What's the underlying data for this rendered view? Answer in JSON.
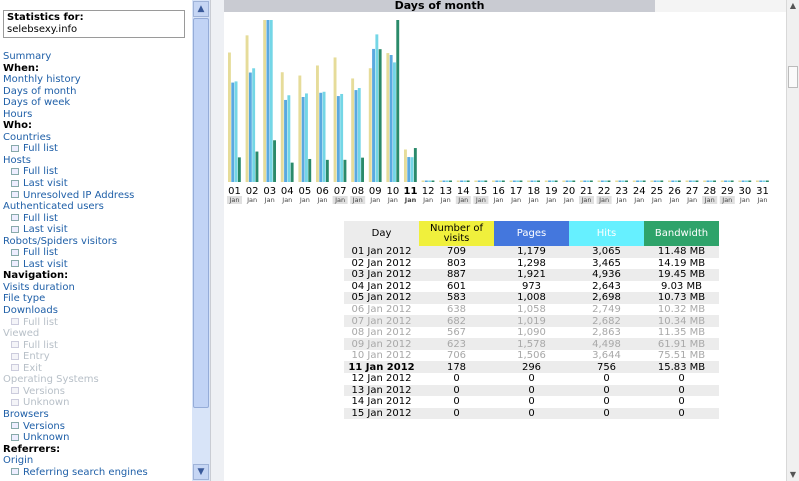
{
  "sidebar": {
    "stats_label": "Statistics for:",
    "site": "selebsexy.info",
    "items": [
      {
        "label": "Summary",
        "kind": "link"
      },
      {
        "label": "When:",
        "kind": "head"
      },
      {
        "label": "Monthly history",
        "kind": "link"
      },
      {
        "label": "Days of month",
        "kind": "link"
      },
      {
        "label": "Days of week",
        "kind": "link"
      },
      {
        "label": "Hours",
        "kind": "link"
      },
      {
        "label": "Who:",
        "kind": "head"
      },
      {
        "label": "Countries",
        "kind": "link"
      },
      {
        "label": "Full list",
        "kind": "sub"
      },
      {
        "label": "Hosts",
        "kind": "link"
      },
      {
        "label": "Full list",
        "kind": "sub"
      },
      {
        "label": "Last visit",
        "kind": "sub"
      },
      {
        "label": "Unresolved IP Address",
        "kind": "sub"
      },
      {
        "label": "Authenticated users",
        "kind": "link"
      },
      {
        "label": "Full list",
        "kind": "sub"
      },
      {
        "label": "Last visit",
        "kind": "sub"
      },
      {
        "label": "Robots/Spiders visitors",
        "kind": "link"
      },
      {
        "label": "Full list",
        "kind": "sub"
      },
      {
        "label": "Last visit",
        "kind": "sub"
      },
      {
        "label": "Navigation:",
        "kind": "head"
      },
      {
        "label": "Visits duration",
        "kind": "link"
      },
      {
        "label": "File type",
        "kind": "link"
      },
      {
        "label": "Downloads",
        "kind": "link"
      },
      {
        "label": "Full list",
        "kind": "sub-dis"
      },
      {
        "label": "Viewed",
        "kind": "dis"
      },
      {
        "label": "Full list",
        "kind": "sub-dis"
      },
      {
        "label": "Entry",
        "kind": "sub-dis"
      },
      {
        "label": "Exit",
        "kind": "sub-dis"
      },
      {
        "label": "Operating Systems",
        "kind": "dis"
      },
      {
        "label": "Versions",
        "kind": "sub-dis"
      },
      {
        "label": "Unknown",
        "kind": "sub-dis"
      },
      {
        "label": "Browsers",
        "kind": "link"
      },
      {
        "label": "Versions",
        "kind": "sub"
      },
      {
        "label": "Unknown",
        "kind": "sub"
      },
      {
        "label": "Referrers:",
        "kind": "head"
      },
      {
        "label": "Origin",
        "kind": "link"
      },
      {
        "label": "Referring search engines",
        "kind": "sub"
      }
    ]
  },
  "panel": {
    "title": "Days of month"
  },
  "chart_data": {
    "type": "bar",
    "categories": [
      "01",
      "02",
      "03",
      "04",
      "05",
      "06",
      "07",
      "08",
      "09",
      "10",
      "11",
      "12",
      "13",
      "14",
      "15",
      "16",
      "17",
      "18",
      "19",
      "20",
      "21",
      "22",
      "23",
      "24",
      "25",
      "26",
      "27",
      "28",
      "29",
      "30",
      "31"
    ],
    "sublabel": "Jan",
    "highlight_days": [
      "11"
    ],
    "weekend_days": [
      "01",
      "07",
      "08",
      "14",
      "15",
      "21",
      "22",
      "28",
      "29"
    ],
    "series": [
      {
        "key": "visits",
        "color": "#e6dc9a",
        "values": [
          709,
          803,
          887,
          601,
          583,
          638,
          682,
          567,
          623,
          706,
          178,
          0,
          0,
          0,
          0,
          0,
          0,
          0,
          0,
          0,
          0,
          0,
          0,
          0,
          0,
          0,
          0,
          0,
          0,
          0,
          0
        ]
      },
      {
        "key": "pages",
        "color": "#5aa9e0",
        "values": [
          1179,
          1298,
          1921,
          973,
          1008,
          1058,
          1019,
          1090,
          1578,
          1506,
          296,
          0,
          0,
          0,
          0,
          0,
          0,
          0,
          0,
          0,
          0,
          0,
          0,
          0,
          0,
          0,
          0,
          0,
          0,
          0,
          0
        ]
      },
      {
        "key": "hits",
        "color": "#74d6e6",
        "values": [
          3065,
          3465,
          4936,
          2643,
          2698,
          2749,
          2682,
          2863,
          4498,
          3644,
          756,
          0,
          0,
          0,
          0,
          0,
          0,
          0,
          0,
          0,
          0,
          0,
          0,
          0,
          0,
          0,
          0,
          0,
          0,
          0,
          0
        ]
      },
      {
        "key": "bandwidth",
        "color": "#2a8a6a",
        "values": [
          11.48,
          14.19,
          19.45,
          9.03,
          10.73,
          10.32,
          10.34,
          11.35,
          61.91,
          75.51,
          15.83,
          0,
          0,
          0,
          0,
          0,
          0,
          0,
          0,
          0,
          0,
          0,
          0,
          0,
          0,
          0,
          0,
          0,
          0,
          0,
          0
        ]
      }
    ]
  },
  "table": {
    "headers": {
      "day": "Day",
      "visits": "Number of visits",
      "pages": "Pages",
      "hits": "Hits",
      "bandwidth": "Bandwidth"
    },
    "rows": [
      {
        "day": "01 Jan 2012",
        "visits": "709",
        "pages": "1,179",
        "hits": "3,065",
        "bandwidth": "11.48 MB"
      },
      {
        "day": "02 Jan 2012",
        "visits": "803",
        "pages": "1,298",
        "hits": "3,465",
        "bandwidth": "14.19 MB"
      },
      {
        "day": "03 Jan 2012",
        "visits": "887",
        "pages": "1,921",
        "hits": "4,936",
        "bandwidth": "19.45 MB"
      },
      {
        "day": "04 Jan 2012",
        "visits": "601",
        "pages": "973",
        "hits": "2,643",
        "bandwidth": "9.03 MB"
      },
      {
        "day": "05 Jan 2012",
        "visits": "583",
        "pages": "1,008",
        "hits": "2,698",
        "bandwidth": "10.73 MB"
      },
      {
        "day": "06 Jan 2012",
        "visits": "638",
        "pages": "1,058",
        "hits": "2,749",
        "bandwidth": "10.32 MB"
      },
      {
        "day": "07 Jan 2012",
        "visits": "682",
        "pages": "1,019",
        "hits": "2,682",
        "bandwidth": "10.34 MB"
      },
      {
        "day": "08 Jan 2012",
        "visits": "567",
        "pages": "1,090",
        "hits": "2,863",
        "bandwidth": "11.35 MB"
      },
      {
        "day": "09 Jan 2012",
        "visits": "623",
        "pages": "1,578",
        "hits": "4,498",
        "bandwidth": "61.91 MB"
      },
      {
        "day": "10 Jan 2012",
        "visits": "706",
        "pages": "1,506",
        "hits": "3,644",
        "bandwidth": "75.51 MB"
      },
      {
        "day": "11 Jan 2012",
        "visits": "178",
        "pages": "296",
        "hits": "756",
        "bandwidth": "15.83 MB"
      },
      {
        "day": "12 Jan 2012",
        "visits": "0",
        "pages": "0",
        "hits": "0",
        "bandwidth": "0"
      },
      {
        "day": "13 Jan 2012",
        "visits": "0",
        "pages": "0",
        "hits": "0",
        "bandwidth": "0"
      },
      {
        "day": "14 Jan 2012",
        "visits": "0",
        "pages": "0",
        "hits": "0",
        "bandwidth": "0"
      },
      {
        "day": "15 Jan 2012",
        "visits": "0",
        "pages": "0",
        "hits": "0",
        "bandwidth": "0"
      }
    ]
  },
  "colors": {
    "link": "#2060a8",
    "visits_header": "#f0f03c",
    "pages_header": "#4477dd",
    "hits_header": "#66f0ff",
    "bandwidth_header": "#2ea36a"
  }
}
